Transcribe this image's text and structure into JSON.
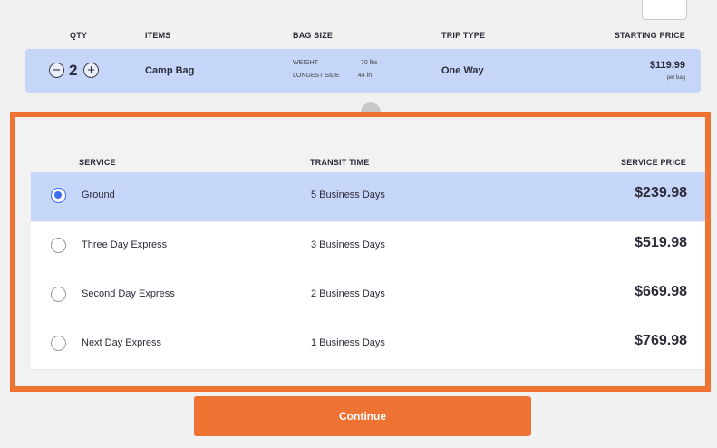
{
  "header": {
    "qty": "QTY",
    "items": "ITEMS",
    "bag_size": "BAG SIZE",
    "trip_type": "TRIP TYPE",
    "starting_price": "STARTING PRICE"
  },
  "item": {
    "minus": "−",
    "qty": "2",
    "plus": "+",
    "name": "Camp Bag",
    "weight_label": "WEIGHT",
    "weight_value": "70 lbs",
    "side_label": "LONGEST SIDE",
    "side_value": "44 in",
    "trip": "One Way",
    "price": "$119.99",
    "price_note": "per bag"
  },
  "services_header": {
    "service": "SERVICE",
    "transit": "TRANSIT TIME",
    "price": "SERVICE PRICE"
  },
  "services": [
    {
      "name": "Ground",
      "transit": "5 Business Days",
      "price": "$239.98",
      "selected": true
    },
    {
      "name": "Three Day Express",
      "transit": "3 Business Days",
      "price": "$519.98",
      "selected": false
    },
    {
      "name": "Second Day Express",
      "transit": "2 Business Days",
      "price": "$669.98",
      "selected": false
    },
    {
      "name": "Next Day Express",
      "transit": "1 Business Days",
      "price": "$769.98",
      "selected": false
    }
  ],
  "continue_label": "Continue",
  "colors": {
    "accent": "#ee7232",
    "selected_row": "#c6d6f8",
    "radio_on": "#3a6cf4"
  }
}
